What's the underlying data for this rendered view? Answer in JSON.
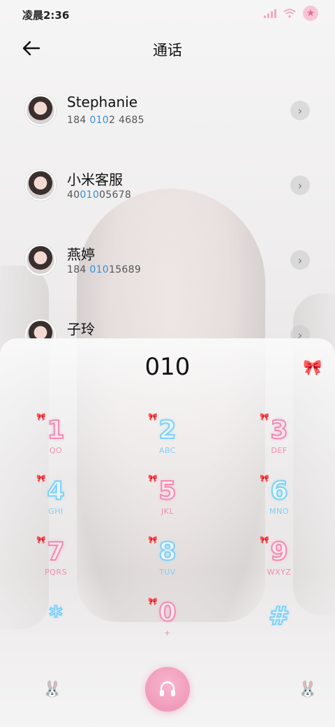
{
  "status": {
    "time": "凌晨2:36"
  },
  "header": {
    "title": "通话"
  },
  "contacts": [
    {
      "name": "Stephanie",
      "num_pre": "184 ",
      "num_hl": "010",
      "num_post": "2 4685"
    },
    {
      "name": "小米客服",
      "num_pre": "40",
      "num_hl": "010",
      "num_post": "05678"
    },
    {
      "name": "燕婷",
      "num_pre": "184 ",
      "num_hl": "010",
      "num_post": "15689"
    },
    {
      "name": "子玲",
      "num_pre": "",
      "num_hl": "",
      "num_post": ""
    }
  ],
  "dialer": {
    "input": "010",
    "keys": [
      {
        "digit": "1",
        "letters": "QO"
      },
      {
        "digit": "2",
        "letters": "ABC"
      },
      {
        "digit": "3",
        "letters": "DEF"
      },
      {
        "digit": "4",
        "letters": "GHI"
      },
      {
        "digit": "5",
        "letters": "JKL"
      },
      {
        "digit": "6",
        "letters": "MNO"
      },
      {
        "digit": "7",
        "letters": "PQRS"
      },
      {
        "digit": "8",
        "letters": "TUV"
      },
      {
        "digit": "9",
        "letters": "WXYZ"
      },
      {
        "digit": "*",
        "letters": ""
      },
      {
        "digit": "0",
        "letters": "+"
      },
      {
        "digit": "#",
        "letters": ""
      }
    ]
  },
  "colors": {
    "pink": "#f08bb1",
    "blue": "#7fcff4",
    "highlight": "#2f8fe0",
    "call": "#ee8fb2"
  },
  "icons": {
    "back": "arrow-left-icon",
    "chevron": "chevron-right-icon",
    "call": "headset-icon",
    "bow": "bow-icon",
    "bunny": "bunny-icon"
  }
}
